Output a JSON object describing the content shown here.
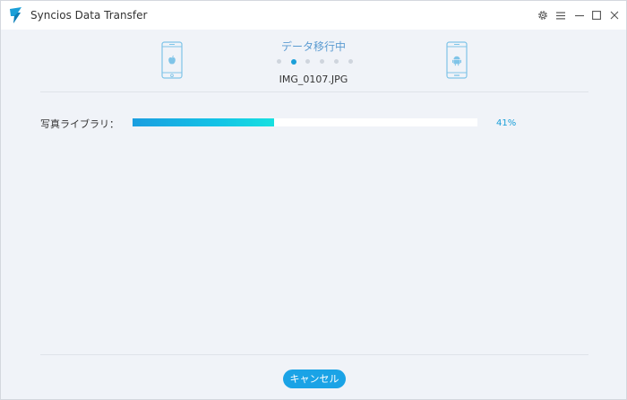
{
  "window": {
    "title": "Syncios Data Transfer"
  },
  "titlebar_controls": [
    {
      "icon": "gear-icon"
    },
    {
      "icon": "menu-icon"
    },
    {
      "icon": "minimize-icon"
    },
    {
      "icon": "maximize-icon"
    },
    {
      "icon": "close-icon"
    }
  ],
  "transfer": {
    "status": "データ移行中",
    "current_file": "IMG_0107.JPG",
    "source_device_icon": "apple-phone-icon",
    "target_device_icon": "android-phone-icon",
    "step_dots": 6,
    "active_step": 2
  },
  "progress": {
    "label": "写真ライブラリ：",
    "value": 0.41,
    "percent_text": "41%"
  },
  "footer": {
    "cancel_label": "キャンセル"
  },
  "colors": {
    "accent": "#1a9fd8",
    "status_text": "#5b9bd1",
    "background": "#f0f3f8",
    "button": "#1aa3e6"
  }
}
